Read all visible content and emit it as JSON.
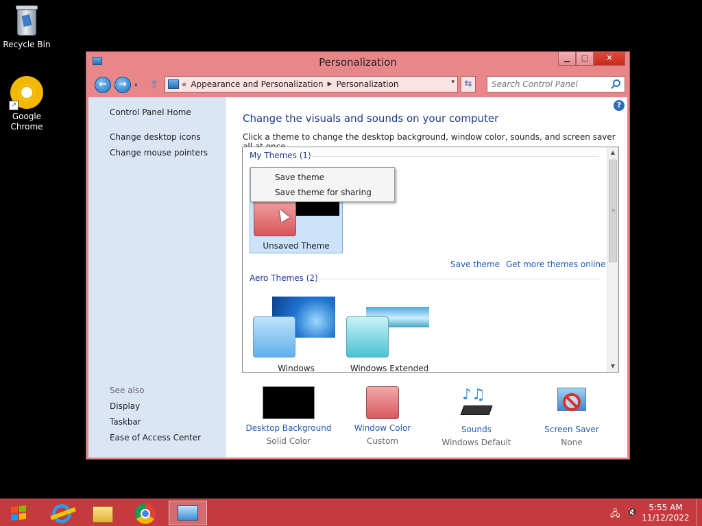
{
  "desktop": {
    "icons": [
      {
        "label": "Recycle Bin"
      },
      {
        "label": "Google Chrome"
      }
    ]
  },
  "window": {
    "title": "Personalization",
    "controls": {
      "minimize": "▁",
      "maximize": "□",
      "close": "✕"
    },
    "nav": {
      "back_glyph": "←",
      "forward_glyph": "→",
      "dropdown_glyph": "▾",
      "up_glyph": "⇧",
      "breadcrumb_lead": "«",
      "breadcrumb": [
        "Appearance and Personalization",
        "Personalization"
      ],
      "breadcrumb_sep": "▶",
      "address_dropdown": "▾",
      "refresh_glyph": "⇆",
      "search_placeholder": "Search Control Panel"
    },
    "sidebar": {
      "links": [
        "Control Panel Home",
        "Change desktop icons",
        "Change mouse pointers"
      ],
      "see_also_label": "See also",
      "see_also": [
        "Display",
        "Taskbar",
        "Ease of Access Center"
      ]
    },
    "main": {
      "help_glyph": "?",
      "heading": "Change the visuals and sounds on your computer",
      "description": "Click a theme to change the desktop background, window color, sounds, and screen saver all at once.",
      "my_themes": {
        "title": "My Themes (1)",
        "themes": [
          {
            "name": "Unsaved Theme",
            "selected": true
          }
        ],
        "links": [
          "Save theme",
          "Get more themes online"
        ]
      },
      "aero_themes": {
        "title": "Aero Themes (2)",
        "themes": [
          {
            "name": "Windows"
          },
          {
            "name": "Windows Extended"
          }
        ]
      },
      "context_menu": [
        "Save theme",
        "Save theme for sharing"
      ],
      "bottom": [
        {
          "title": "Desktop Background",
          "sub": "Solid Color",
          "icon": "black-swatch-icon"
        },
        {
          "title": "Window Color",
          "sub": "Custom",
          "icon": "red-swatch-icon"
        },
        {
          "title": "Sounds",
          "sub": "Windows Default",
          "icon": "music-notes-icon"
        },
        {
          "title": "Screen Saver",
          "sub": "None",
          "icon": "screen-saver-none-icon"
        }
      ]
    }
  },
  "taskbar": {
    "apps": [
      "start-button",
      "internet-explorer",
      "file-explorer",
      "google-chrome",
      "control-panel"
    ],
    "clock": {
      "time": "5:55 AM",
      "date": "11/12/2022"
    }
  },
  "colors": {
    "accent": "#e8868a",
    "taskbar": "#c43a3f",
    "link": "#1e5bb8",
    "sidebar": "#dbe6f5"
  }
}
